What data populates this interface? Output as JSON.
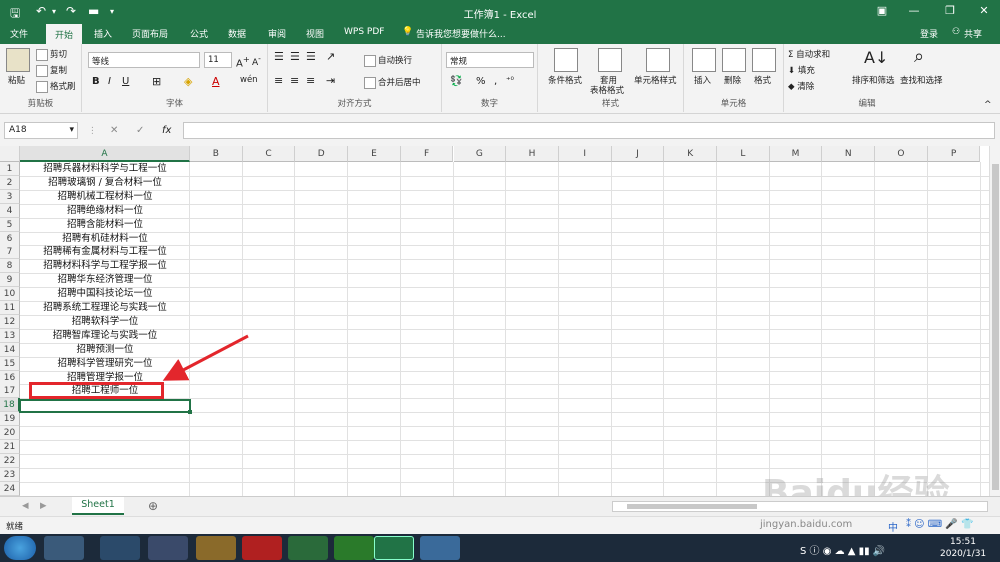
{
  "window": {
    "title": "工作簿1 - Excel"
  },
  "ribbon_tabs": {
    "file": "文件",
    "home": "开始",
    "insert": "插入",
    "layout": "页面布局",
    "formulas": "公式",
    "data": "数据",
    "review": "审阅",
    "view": "视图",
    "wps": "WPS PDF",
    "tellme": "告诉我您想要做什么...",
    "login": "登录",
    "share": "共享"
  },
  "ribbon": {
    "paste": "粘贴",
    "cut": "剪切",
    "copy": "复制",
    "format_painter": "格式刷",
    "clipboard": "剪贴板",
    "font_name": "等线",
    "font_size": "11",
    "font_group": "字体",
    "wrap": "自动换行",
    "merge": "合并后居中",
    "align_group": "对齐方式",
    "number_format": "常规",
    "number_group": "数字",
    "cond_format": "条件格式",
    "table_format_1": "套用",
    "table_format_2": "表格格式",
    "cell_style": "单元格样式",
    "styles_group": "样式",
    "insert_cell": "插入",
    "delete_cell": "删除",
    "format_cell": "格式",
    "cells_group": "单元格",
    "autosum": "自动求和",
    "fill": "填充",
    "clear": "清除",
    "sort_filter": "排序和筛选",
    "find_select": "查找和选择",
    "edit_group": "编辑"
  },
  "formula_bar": {
    "name_box": "A18",
    "fx": "fx",
    "formula": ""
  },
  "columns": [
    "A",
    "B",
    "C",
    "D",
    "E",
    "F",
    "G",
    "H",
    "I",
    "J",
    "K",
    "L",
    "M",
    "N",
    "O",
    "P"
  ],
  "rows": [
    "1",
    "2",
    "3",
    "4",
    "5",
    "6",
    "7",
    "8",
    "9",
    "10",
    "11",
    "12",
    "13",
    "14",
    "15",
    "16",
    "17",
    "18",
    "19",
    "20",
    "21",
    "22",
    "23",
    "24"
  ],
  "cells_a": [
    "招聘兵器材料科学与工程一位",
    "招聘玻璃钢 / 复合材料一位",
    "招聘机械工程材料一位",
    "招聘绝缘材料一位",
    "招聘含能材料一位",
    "招聘有机硅材料一位",
    "招聘稀有金属材料与工程一位",
    "招聘材料科学与工程学报一位",
    "招聘华东经济管理一位",
    "招聘中国科技论坛一位",
    "招聘系统工程理论与实践一位",
    "招聘软科学一位",
    "招聘智库理论与实践一位",
    "招聘预测一位",
    "招聘科学管理研究一位",
    "招聘管理学报一位",
    "招聘工程师一位"
  ],
  "sheet_tab": "Sheet1",
  "status": "就绪",
  "clock": {
    "time": "15:51",
    "date": "2020/1/31"
  },
  "tray_ime": "中",
  "watermark": "Baidu经验",
  "watermark_url": "jingyan.baidu.com",
  "colors": {
    "excel_green": "#217346",
    "annotation_red": "#e3262c",
    "selection_green": "#217346"
  }
}
